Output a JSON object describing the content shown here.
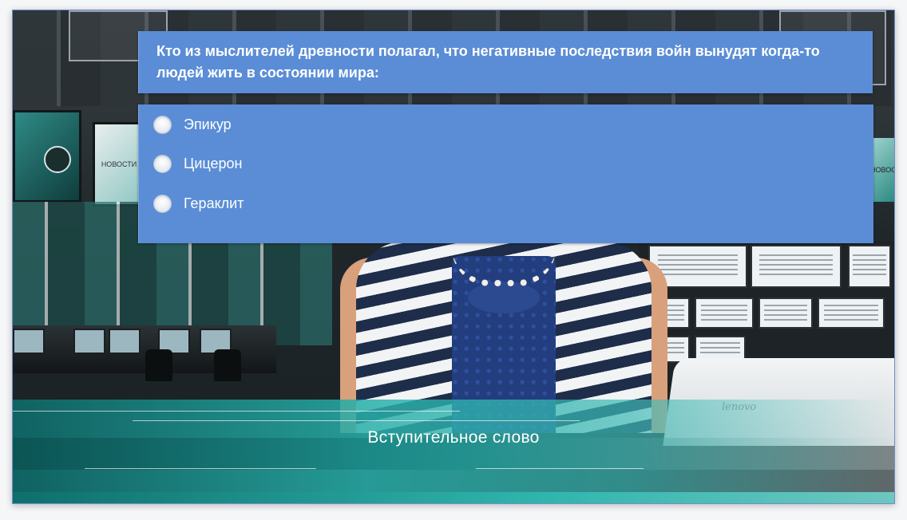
{
  "quiz": {
    "question": "Кто из мыслителей древности полагал, что негативные последствия войн вынудят когда-то людей жить в состоянии мира:",
    "options": [
      {
        "label": "Эпикур"
      },
      {
        "label": "Цицерон"
      },
      {
        "label": "Гераклит"
      }
    ]
  },
  "video": {
    "lower_third_title": "Вступительное слово",
    "screen_news_label": "НОВОСТИ",
    "screen_right_label": "НОВОС",
    "laptop_brand": "lenovo"
  },
  "colors": {
    "quiz_panel": "#5a8dd6",
    "lower_third_accent": "#2fb5ad"
  }
}
